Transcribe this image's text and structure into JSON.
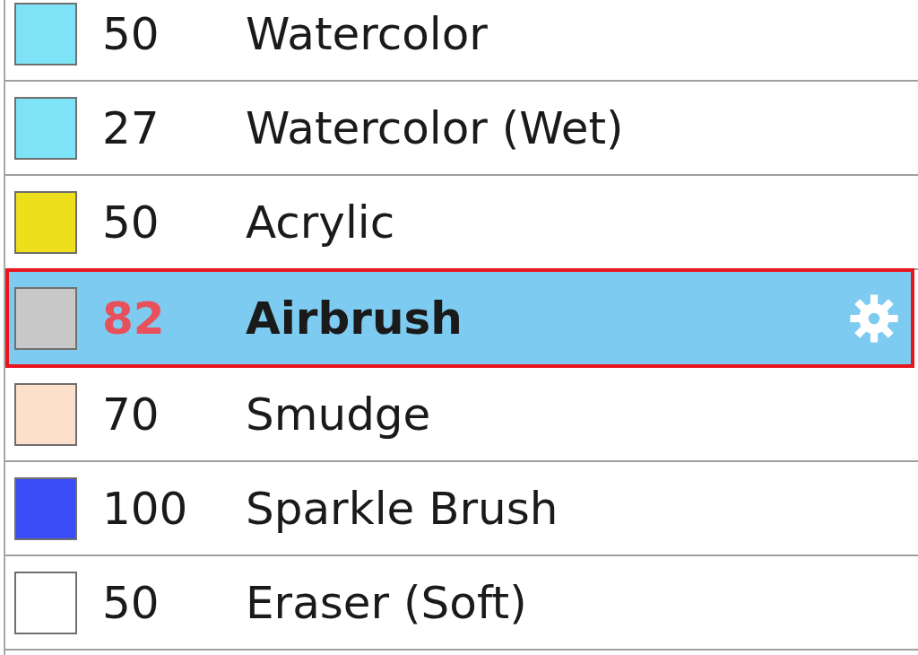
{
  "brushes": [
    {
      "size": "50",
      "name": "Watercolor",
      "color": "#7fe3f7",
      "selected": false
    },
    {
      "size": "27",
      "name": "Watercolor (Wet)",
      "color": "#7fe3f7",
      "selected": false
    },
    {
      "size": "50",
      "name": "Acrylic",
      "color": "#eedf1d",
      "selected": false
    },
    {
      "size": "82",
      "name": "Airbrush",
      "color": "#c8c8c8",
      "selected": true
    },
    {
      "size": "70",
      "name": "Smudge",
      "color": "#fde0cc",
      "selected": false
    },
    {
      "size": "100",
      "name": "Sparkle Brush",
      "color": "#3a4cf5",
      "selected": false
    },
    {
      "size": "50",
      "name": "Eraser (Soft)",
      "color": "#ffffff",
      "selected": false
    }
  ]
}
